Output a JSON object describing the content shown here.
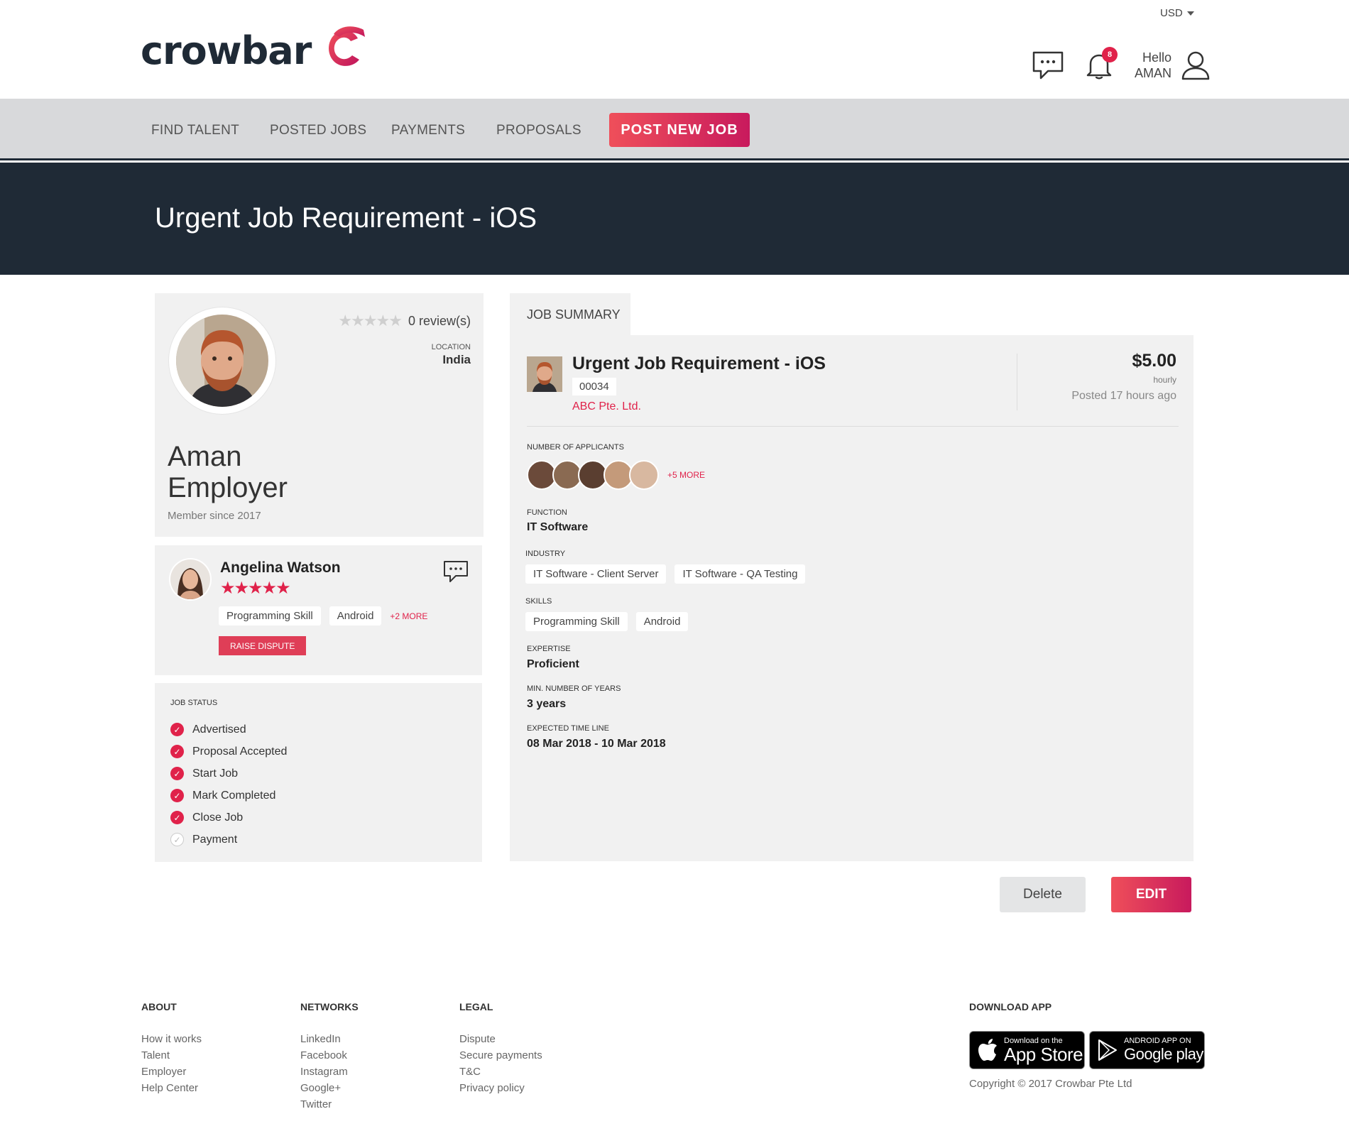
{
  "header": {
    "currency": "USD",
    "logo_text": "crowbar",
    "notifications_count": "8",
    "greeting": "Hello",
    "username": "AMAN"
  },
  "nav": {
    "items": [
      {
        "label": "FIND TALENT"
      },
      {
        "label": "POSTED JOBS"
      },
      {
        "label": "PAYMENTS"
      },
      {
        "label": "PROPOSALS"
      }
    ],
    "cta": "POST NEW JOB"
  },
  "banner": {
    "title": "Urgent Job Requirement - iOS"
  },
  "profile": {
    "rating": 0,
    "reviews": "0 review(s)",
    "location_label": "LOCATION",
    "location": "India",
    "name_line1": "Aman",
    "name_line2": "Employer",
    "member_since": "Member since 2017"
  },
  "talent": {
    "name": "Angelina Watson",
    "rating": 5,
    "skills": [
      "Programming Skill",
      "Android"
    ],
    "more": "+2 MORE",
    "dispute_label": "RAISE DISPUTE"
  },
  "job_status": {
    "label": "JOB STATUS",
    "steps": [
      {
        "label": "Advertised",
        "done": true
      },
      {
        "label": "Proposal Accepted",
        "done": true
      },
      {
        "label": "Start Job",
        "done": true
      },
      {
        "label": "Mark Completed",
        "done": true
      },
      {
        "label": "Close Job",
        "done": true
      },
      {
        "label": "Payment",
        "done": false
      }
    ]
  },
  "summary": {
    "tab_label": "JOB SUMMARY",
    "title": "Urgent Job Requirement - iOS",
    "code": "00034",
    "company": "ABC Pte. Ltd.",
    "price": "$5.00",
    "rate_unit": "hourly",
    "posted": "Posted 17 hours ago",
    "applicants_label": "NUMBER OF APPLICANTS",
    "applicants_more": "+5 MORE",
    "function_label": "FUNCTION",
    "function": "IT Software",
    "industry_label": "INDUSTRY",
    "industries": [
      "IT Software - Client Server",
      "IT Software - QA Testing"
    ],
    "skills_label": "SKILLS",
    "skills": [
      "Programming Skill",
      "Android"
    ],
    "expertise_label": "EXPERTISE",
    "expertise": "Proficient",
    "years_label": "MIN. NUMBER OF YEARS",
    "years": "3 years",
    "timeline_label": "EXPECTED TIME LINE",
    "timeline": "08 Mar 2018 - 10 Mar 2018"
  },
  "actions": {
    "delete": "Delete",
    "edit": "EDIT"
  },
  "footer": {
    "about": {
      "heading": "ABOUT",
      "links": [
        "How it works",
        "Talent",
        "Employer",
        "Help Center"
      ]
    },
    "networks": {
      "heading": "NETWORKS",
      "links": [
        "LinkedIn",
        "Facebook",
        "Instagram",
        "Google+",
        "Twitter"
      ]
    },
    "legal": {
      "heading": "LEGAL",
      "links": [
        "Dispute",
        "Secure payments",
        "T&C",
        "Privacy policy"
      ]
    },
    "download": {
      "heading": "DOWNLOAD APP",
      "appstore_small": "Download on the",
      "appstore_big": "App Store",
      "googleplay_small": "ANDROID APP ON",
      "googleplay_big": "Google play"
    },
    "copyright": "Copyright © 2017 Crowbar Pte Ltd"
  },
  "colors": {
    "accent": "#e0224a",
    "dark": "#1f2a36",
    "panel": "#f1f1f1",
    "nav": "#d8d9db"
  },
  "icons": [
    "caret-down-icon",
    "chat-icon",
    "bell-icon",
    "user-icon",
    "star-icon",
    "check-icon",
    "apple-icon",
    "play-icon"
  ]
}
